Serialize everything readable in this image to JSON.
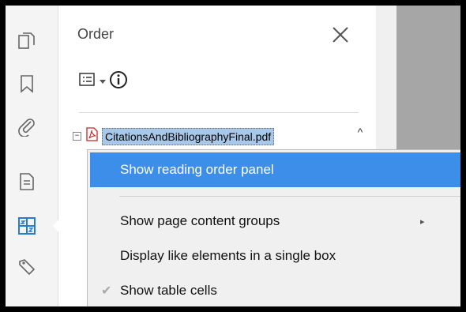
{
  "left_rail": {
    "icons": [
      "pages-icon",
      "bookmark-icon",
      "attachment-icon",
      "document-icon",
      "order-icon",
      "tag-icon"
    ]
  },
  "panel": {
    "title": "Order",
    "close_symbol": "✕",
    "tree": {
      "expander": "−",
      "file_name": "CitationsAndBibliographyFinal.pdf"
    },
    "scroll_up": "^"
  },
  "context_menu": {
    "items": [
      {
        "label": "Show reading order panel",
        "active": true
      },
      {
        "label": "Show page content groups",
        "submenu": true
      },
      {
        "label": "Display like elements in a single box"
      },
      {
        "label": "Show table cells",
        "checked": true
      }
    ],
    "submenu_arrow": "▸",
    "check_mark": "✔"
  },
  "colors": {
    "highlight": "#3d8ee8",
    "selection": "#a8c8ea",
    "active_icon": "#2a7ad2"
  }
}
